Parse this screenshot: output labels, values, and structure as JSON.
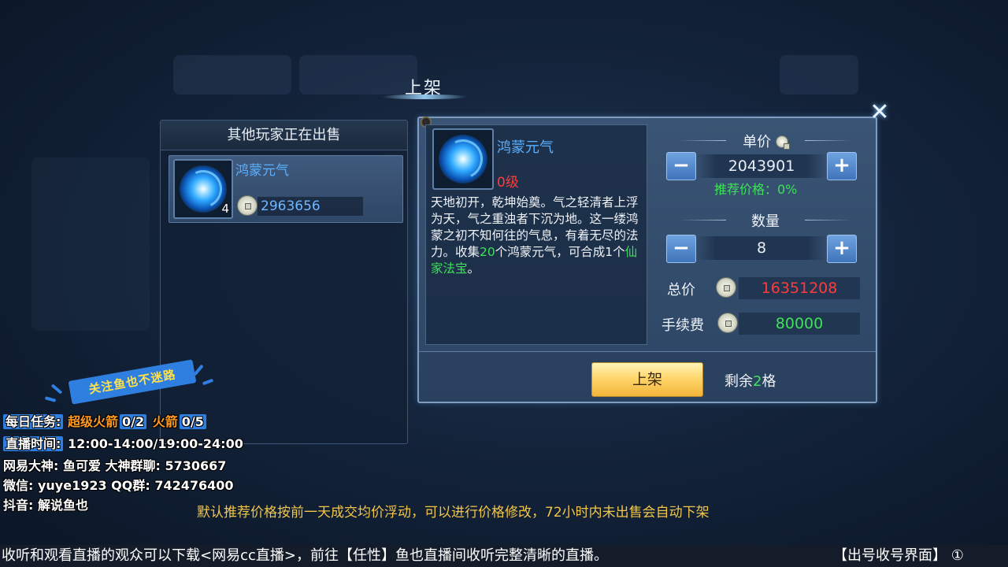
{
  "window": {
    "title": "上架",
    "close_icon": "close-x-icon"
  },
  "left_panel": {
    "title": "其他玩家正在出售",
    "listings": [
      {
        "name": "鸿蒙元气",
        "quantity": "4",
        "price": "2963656"
      }
    ]
  },
  "item_detail": {
    "name": "鸿蒙元气",
    "level": "0级",
    "description_parts": [
      {
        "text": "天地初开，乾坤始奠。气之轻清者上浮为天，气之重浊者下沉为地。这一缕鸿蒙之初不知何往的气息，有着无尽的法力。收集",
        "color": "white"
      },
      {
        "text": "20",
        "color": "green"
      },
      {
        "text": "个鸿蒙元气，可合成1个",
        "color": "white"
      },
      {
        "text": "仙家法宝",
        "color": "green"
      },
      {
        "text": "。",
        "color": "white"
      }
    ]
  },
  "pricing": {
    "unit_price_label": "单价",
    "unit_price": "2043901",
    "recommend_label": "推荐价格：0%",
    "quantity_label": "数量",
    "quantity": "8",
    "total_label": "总价",
    "total": "16351208",
    "fee_label": "手续费",
    "fee": "80000",
    "minus_label": "−",
    "plus_label": "+"
  },
  "actions": {
    "list_button": "上架",
    "remaining_prefix": "剩余",
    "remaining_count": "2",
    "remaining_suffix": "格"
  },
  "footer_tip": "默认推荐价格按前一天成交均价浮动，可以进行价格修改，72小时内未出售会自动下架",
  "stream_overlay": {
    "follow_banner": "关注鱼也不迷路",
    "daily_task_label": "每日任务:",
    "task1_name": "超级火箭",
    "task1_progress": "0/2",
    "task2_name": "火箭",
    "task2_progress": "0/5",
    "live_time_label": "直播时间:",
    "live_time": "12:00-14:00/19:00-24:00",
    "line3": "网易大神: 鱼可爱   大神群聊: 5730667",
    "line4": "微信: yuye1923   QQ群: 742476400",
    "line5": "抖音: 解说鱼也"
  },
  "ticker": {
    "text": "收听和观看直播的观众可以下载<网易cc直播>，前往【任性】鱼也直播间收听完整清晰的直播。",
    "right_text": "【出号收号界面】 ①"
  },
  "colors": {
    "accent_blue": "#5ab0ff",
    "price_red": "#ff3b3b",
    "hint_green": "#3fe05a",
    "button_gold": "#ffd66b",
    "tip_yellow": "#f1c64a"
  }
}
